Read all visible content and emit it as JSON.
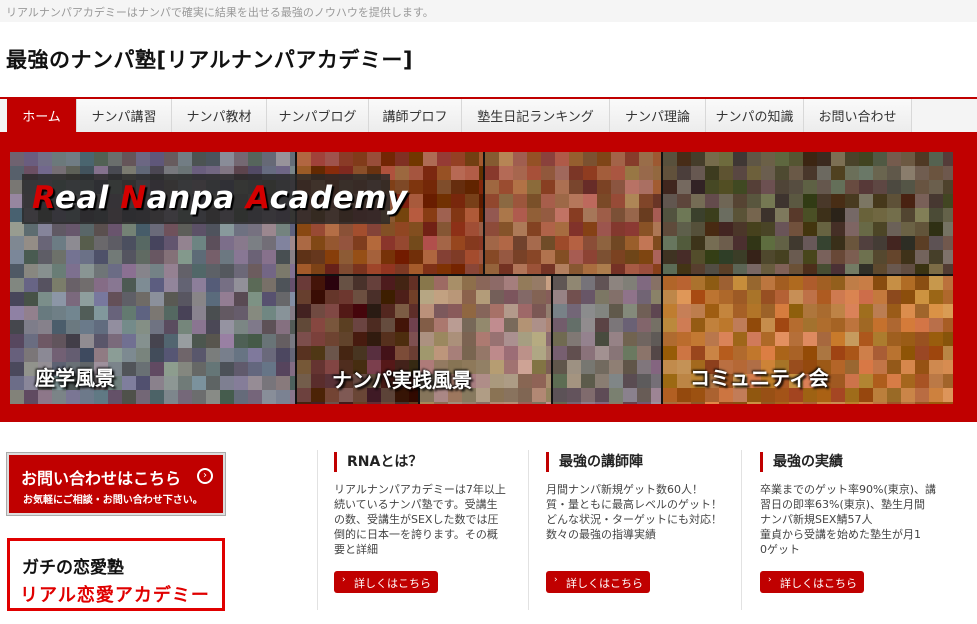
{
  "header": {
    "tagline": "リアルナンパアカデミーはナンパで確実に結果を出せる最強のノウハウを提供します。",
    "site_title": "最強のナンパ塾[リアルナンパアカデミー]"
  },
  "nav": {
    "items": [
      {
        "label": "ホーム",
        "active": true
      },
      {
        "label": "ナンパ講習"
      },
      {
        "label": "ナンパ教材"
      },
      {
        "label": "ナンパブログ"
      },
      {
        "label": "講師プロフ"
      },
      {
        "label": "塾生日記ランキング"
      },
      {
        "label": "ナンパ理論"
      },
      {
        "label": "ナンパの知識"
      },
      {
        "label": "お問い合わせ"
      }
    ]
  },
  "banner": {
    "logo_parts": [
      "R",
      "eal ",
      "N",
      "anpa ",
      "A",
      "cademy"
    ],
    "captions": {
      "lecture": "座学風景",
      "practice": "ナンパ実践風景",
      "community": "コミュニティ会"
    }
  },
  "sidebar": {
    "contact_main": "お問い合わせはこちら",
    "contact_arrow": "›",
    "contact_sub": "お気軽にご相談・お問い合わせ下さい。",
    "love_line1": "ガチの恋愛塾",
    "love_line2": "リアル恋愛アカデミー"
  },
  "columns": [
    {
      "heading": "RNAとは？",
      "lines": [
        "リアルナンパアカデミーは7年以上",
        "続いているナンパ塾です。受講生",
        "の数、受講生がSEXした数では圧",
        "倒的に日本一を誇ります。その概",
        "要と詳細"
      ],
      "button": "詳しくはこちら"
    },
    {
      "heading": "最強の講師陣",
      "lines": [
        "月間ナンパ新規ゲット数60人！",
        "質・量ともに最高レベルのゲット！",
        "どんな状況・ターゲットにも対応！",
        "数々の最強の指導実績"
      ],
      "button": "詳しくはこちら"
    },
    {
      "heading": "最強の実績",
      "lines": [
        "卒業までのゲット率90%(東京)、講",
        "習日の即率63%(東京)、塾生月間",
        "ナンパ新規SEX鯖57人",
        "童貞から受講を始めた塾生が月1",
        "0ゲット"
      ],
      "button": "詳しくはこちら"
    }
  ],
  "colors": {
    "accent": "#c00000",
    "nav_bg": "#f4f4f4",
    "text": "#222222"
  }
}
